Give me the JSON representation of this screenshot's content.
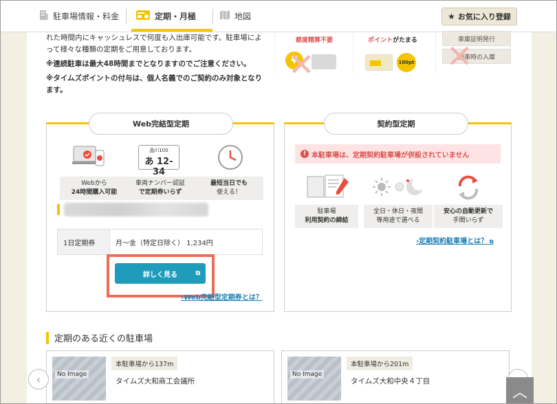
{
  "header": {
    "tabs": [
      {
        "label": "駐車場情報・料金",
        "icon": "building-icon"
      },
      {
        "label": "定期・月極",
        "icon": "calendar-card-icon",
        "active": true
      },
      {
        "label": "地図",
        "icon": "map-icon"
      }
    ],
    "favorite_label": "お気に入り登録"
  },
  "intro": {
    "line1": "れた時間内にキャッシュレスで何度も入出庫可能です。駐車場によって様々な種類の定期をご用意しております。",
    "note1": "※連続駐車は最大48時間までとなりますのでご注意ください。",
    "note2": "※タイムズポイントの付与は、個人名義でのご契約のみ対象となります。"
  },
  "features": {
    "col1_text": "都度精算不要",
    "col2_text_a": "ポイント",
    "col2_text_b": "がたまる",
    "points_badge": "100pt",
    "gray1": "車庫証明発行",
    "gray2": "満車時の入庫"
  },
  "web": {
    "title": "Web完結型定期",
    "cards": [
      {
        "line1": "Webから",
        "line2": "24時間購入可能"
      },
      {
        "line1": "車両ナンバー認証",
        "line2": "で定期券いらず"
      },
      {
        "line1": "最短当日でも",
        "line2": "使える！"
      }
    ],
    "plate_top": "品川100",
    "plate_main": "あ 12-34",
    "price_key": "1日定期券",
    "price_val": "月〜金（特定日除く） 1,234円",
    "detail_label": "詳しく見る",
    "link": "Web完結型定期券とは？"
  },
  "contract": {
    "title": "契約型定期",
    "alert": "本駐車場は、定期契約駐車場が併設されていません",
    "cards": [
      {
        "line1": "駐車場",
        "line2": "利用契約の締結"
      },
      {
        "line1": "全日・休日・夜間",
        "line2": "等用途で選べる"
      },
      {
        "line1": "安心の自動更新で",
        "line2": "手間いらず"
      }
    ],
    "link": "定期契約駐車場とは？"
  },
  "nearby": {
    "heading": "定期のある近くの駐車場",
    "items": [
      {
        "distance": "本駐車場から137m",
        "name": "タイムズ大和商工会議所",
        "image_text": "No Image"
      },
      {
        "distance": "本駐車場から201m",
        "name": "タイムズ大和中央４丁目",
        "image_text": "No Image"
      }
    ]
  },
  "colors": {
    "accent": "#f5c400",
    "button": "#1f9cbb",
    "highlight": "#ef6b5a",
    "alert": "#d9534f"
  }
}
